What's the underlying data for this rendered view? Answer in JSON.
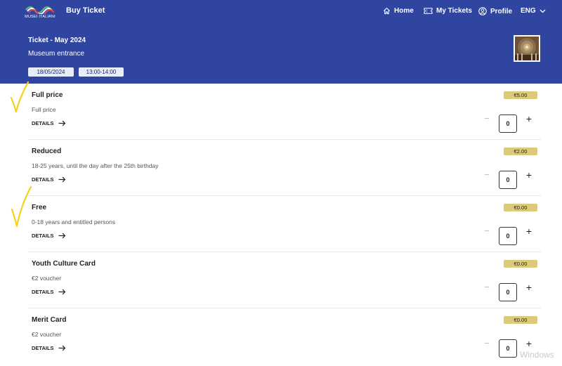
{
  "header": {
    "logo_text": "MUSEI ITALIANI",
    "app_title": "Buy Ticket",
    "nav": {
      "home": "Home",
      "my_tickets": "My Tickets",
      "profile": "Profile",
      "language": "ENG"
    }
  },
  "ticket": {
    "title": "Ticket - May 2024",
    "subtitle": "Museum entrance",
    "date": "18/05/2024",
    "time": "13:00-14:00"
  },
  "details_label": "DETAILS",
  "rows": [
    {
      "name": "Full price",
      "description": "Full price",
      "price": "€5.00",
      "quantity": "0"
    },
    {
      "name": "Reduced",
      "description": "18-25 years, until the day after the 25th birthday",
      "price": "€2.00",
      "quantity": "0"
    },
    {
      "name": "Free",
      "description": "0-18 years and entitled persons",
      "price": "€0.00",
      "quantity": "0"
    },
    {
      "name": "Youth Culture Card",
      "description": "€2 voucher",
      "price": "€0.00",
      "quantity": "0"
    },
    {
      "name": "Merit Card",
      "description": "€2 voucher",
      "price": "€0.00",
      "quantity": "0"
    }
  ],
  "colors": {
    "header_bg": "#2f45a0",
    "price_badge": "#dcc97a",
    "chip_bg": "#e8ecf8",
    "annotation": "#f2d21b"
  },
  "os_watermark": "Windows"
}
